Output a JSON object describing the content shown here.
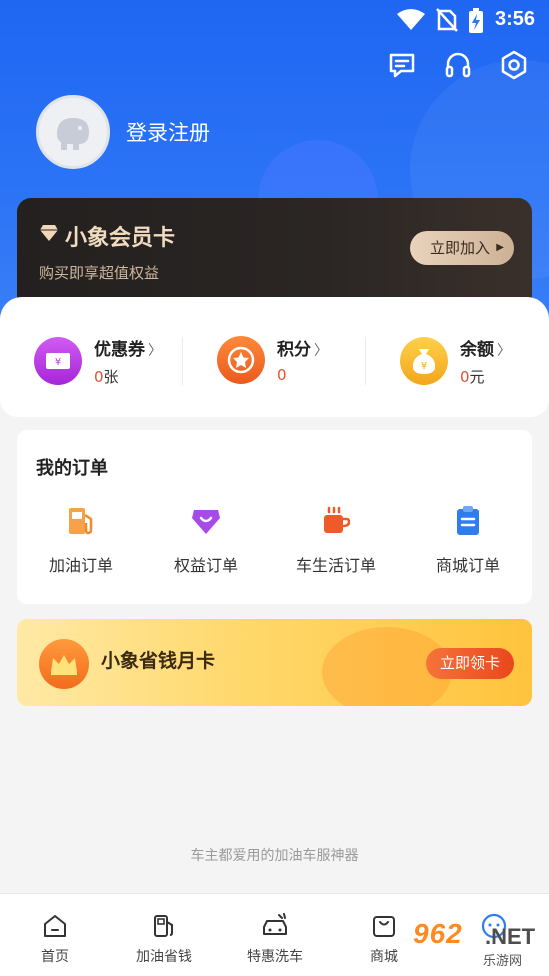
{
  "status_bar": {
    "time": "3:56"
  },
  "header": {
    "icons": [
      "message-icon",
      "headset-icon",
      "settings-icon"
    ]
  },
  "profile": {
    "login_label": "登录注册"
  },
  "vip_card": {
    "title": "小象会员卡",
    "subtitle": "购买即享超值权益",
    "button": "立即加入"
  },
  "assets": [
    {
      "name": "优惠券",
      "value": "0",
      "unit": "张",
      "icon": "coupon-icon",
      "color": "#b53be0"
    },
    {
      "name": "积分",
      "value": "0",
      "unit": "",
      "icon": "points-star-icon",
      "color": "#f2702a"
    },
    {
      "name": "余额",
      "value": "0",
      "unit": "元",
      "icon": "money-bag-icon",
      "color": "#f5b428"
    }
  ],
  "orders": {
    "title": "我的订单",
    "items": [
      {
        "label": "加油订单",
        "icon": "fuel-pump-icon"
      },
      {
        "label": "权益订单",
        "icon": "benefit-bag-icon"
      },
      {
        "label": "车生活订单",
        "icon": "coffee-cup-icon"
      },
      {
        "label": "商城订单",
        "icon": "clipboard-icon"
      }
    ]
  },
  "month_card": {
    "title": "小象省钱月卡",
    "button": "立即领卡"
  },
  "slogan": "车主都爱用的加油车服神器",
  "tabbar": [
    {
      "label": "首页",
      "icon": "home-icon"
    },
    {
      "label": "加油省钱",
      "icon": "fuel-station-icon"
    },
    {
      "label": "特惠洗车",
      "icon": "car-wash-icon"
    },
    {
      "label": "商城",
      "icon": "shopping-bag-icon"
    },
    {
      "label": "",
      "icon": "profile-icon"
    }
  ],
  "watermark": {
    "num": "962",
    "net": ".NET",
    "cn": "乐游网"
  },
  "colors": {
    "primary_blue": "#1f66f2",
    "accent_orange": "#e5512b",
    "vip_dark": "#2b2624"
  }
}
